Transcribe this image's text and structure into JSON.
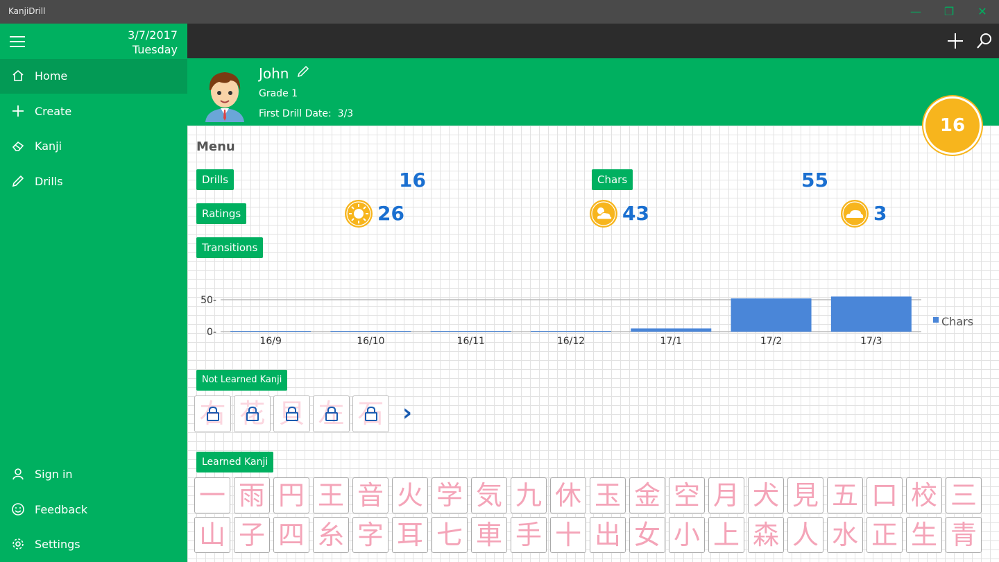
{
  "app": {
    "title": "KanjiDrill"
  },
  "window": {
    "minimize": "—",
    "restore": "❐",
    "close": "✕"
  },
  "sidebar": {
    "date": "3/7/2017",
    "weekday": "Tuesday",
    "items": [
      {
        "label": "Home",
        "icon": "home-icon"
      },
      {
        "label": "Create",
        "icon": "plus-icon"
      },
      {
        "label": "Kanji",
        "icon": "eraser-icon"
      },
      {
        "label": "Drills",
        "icon": "pencil-icon"
      }
    ],
    "bottom": [
      {
        "label": "Sign in",
        "icon": "person-icon"
      },
      {
        "label": "Feedback",
        "icon": "smiley-icon"
      },
      {
        "label": "Settings",
        "icon": "gear-icon"
      }
    ]
  },
  "topbar": {
    "add_icon": "plus-icon",
    "search_icon": "search-icon"
  },
  "profile": {
    "name": "John",
    "grade": "Grade 1",
    "first_drill_label": "First Drill Date:",
    "first_drill_value": "3/3",
    "badge": "16"
  },
  "menu": {
    "heading": "Menu",
    "drills_label": "Drills",
    "drills_value": "16",
    "chars_label": "Chars",
    "chars_value": "55",
    "ratings_label": "Ratings",
    "rating_sunny": "26",
    "rating_partly": "43",
    "rating_cloudy": "3",
    "transitions_label": "Transitions"
  },
  "chart_data": {
    "type": "bar",
    "categories": [
      "16/9",
      "16/10",
      "16/11",
      "16/12",
      "17/1",
      "17/2",
      "17/3"
    ],
    "series": [
      {
        "name": "Chars",
        "values": [
          0,
          0,
          0,
          0,
          5,
          52,
          55
        ]
      }
    ],
    "ylim": [
      0,
      50
    ],
    "yticks": [
      "0",
      "50"
    ],
    "legend": "right",
    "color": "#4a86d8"
  },
  "not_learned": {
    "label": "Not Learned Kanji",
    "ghost": [
      "右",
      "花",
      "貝",
      "左",
      "石"
    ],
    "next": "›"
  },
  "learned": {
    "label": "Learned Kanji",
    "row1": [
      "一",
      "雨",
      "円",
      "王",
      "音",
      "火",
      "学",
      "気",
      "九",
      "休",
      "玉",
      "金",
      "空",
      "月",
      "犬",
      "見",
      "五",
      "口",
      "校",
      "三"
    ],
    "row2": [
      "山",
      "子",
      "四",
      "糸",
      "字",
      "耳",
      "七",
      "車",
      "手",
      "十",
      "出",
      "女",
      "小",
      "上",
      "森",
      "人",
      "水",
      "正",
      "生",
      "青"
    ]
  }
}
